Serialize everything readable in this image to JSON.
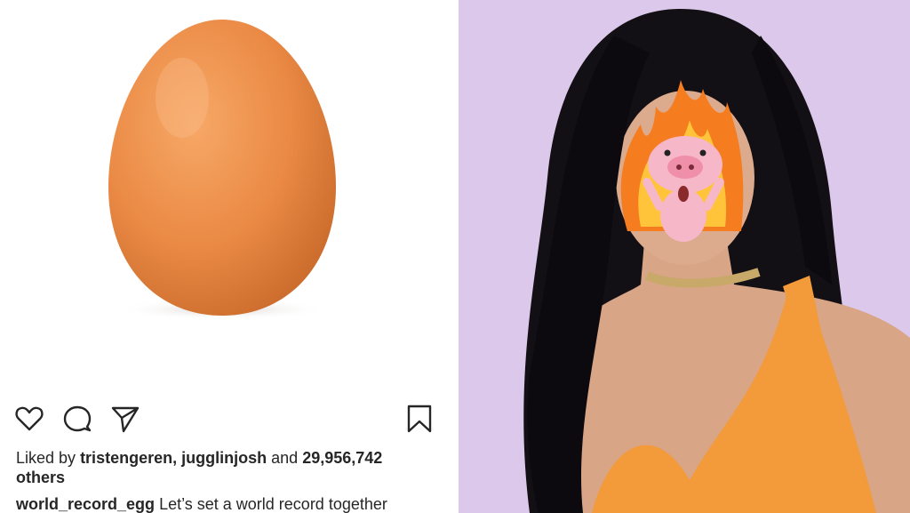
{
  "post": {
    "liked_by_prefix": "Liked by",
    "liker_1": "tristengeren,",
    "liker_2": "jugglinjosh",
    "and_word": "and",
    "like_count": "29,956,742",
    "others_word": "others",
    "caption_user": "world_record_egg",
    "caption_text": "Let’s set a world record together"
  },
  "icons": {
    "like": "heart-icon",
    "comment": "comment-icon",
    "share": "send-icon",
    "save": "bookmark-icon"
  },
  "colors": {
    "text": "#262626",
    "egg": "#e88a45",
    "backdrop": "#dcc8ea",
    "dress": "#f39a3a"
  }
}
